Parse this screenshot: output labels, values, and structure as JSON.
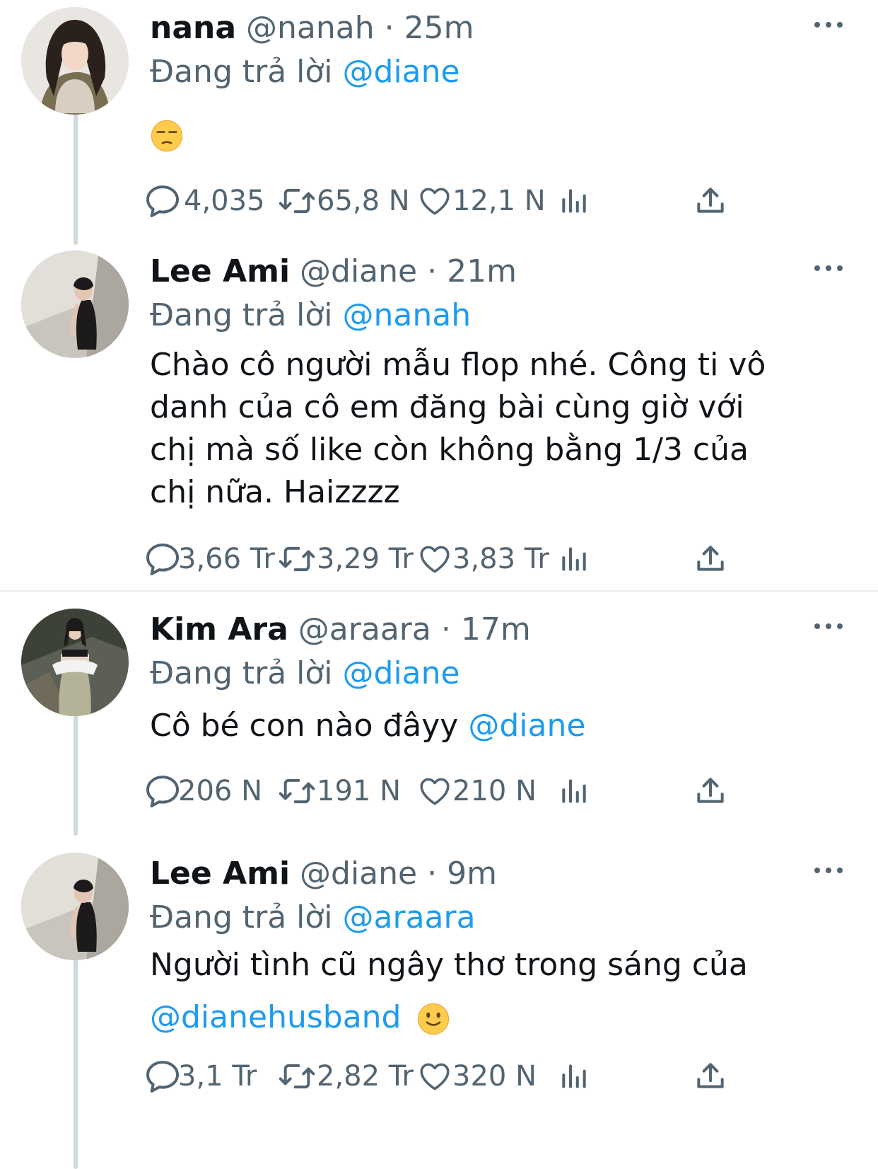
{
  "tweets": [
    {
      "name": "nana",
      "handle": "@nanah",
      "time": "25m",
      "replying_prefix": "Đang trả lời",
      "replying_to": "@diane",
      "body_emoji": "unamused-face-emoji",
      "stats": {
        "replies": "4,035",
        "retweets": "65,8 N",
        "likes": "12,1 N"
      }
    },
    {
      "name": "Lee Ami",
      "handle": "@diane",
      "time": "21m",
      "replying_prefix": "Đang trả lời",
      "replying_to": "@nanah",
      "body_lines": [
        "Chào cô người mẫu flop nhé. Công ti vô",
        "danh của cô em đăng bài cùng giờ với",
        "chị mà số like còn không bằng 1/3 của",
        "chị nữa. Haizzzz"
      ],
      "stats": {
        "replies": "3,66 Tr",
        "retweets": "3,29 Tr",
        "likes": "3,83 Tr"
      }
    },
    {
      "name": "Kim Ara",
      "handle": "@araara",
      "time": "17m",
      "replying_prefix": "Đang trả lời",
      "replying_to": "@diane",
      "body_text": "Cô bé con nào đâyy",
      "body_mention": "@diane",
      "stats": {
        "replies": "206 N",
        "retweets": "191 N",
        "likes": "210 N"
      }
    },
    {
      "name": "Lee Ami",
      "handle": "@diane",
      "time": "9m",
      "replying_prefix": "Đang trả lời",
      "replying_to": "@araara",
      "body_text": "Người tình cũ ngây thơ trong sáng của",
      "body_mention": "@dianehusband",
      "body_emoji": "slightly-smiling-face-emoji",
      "stats": {
        "replies": "3,1 Tr",
        "retweets": "2,82 Tr",
        "likes": "320 N"
      }
    }
  ],
  "separator": "·",
  "icons": {
    "reply": "speech-bubble-icon",
    "retweet": "retweet-icon",
    "like": "heart-icon",
    "views": "bar-chart-icon",
    "share": "share-upload-icon",
    "more": "more-dots-icon"
  },
  "colors": {
    "link": "#1d9bf0",
    "muted": "#536471",
    "text": "#0f1419",
    "thread_line": "#cfd9de",
    "divider": "#e6ecf0"
  }
}
